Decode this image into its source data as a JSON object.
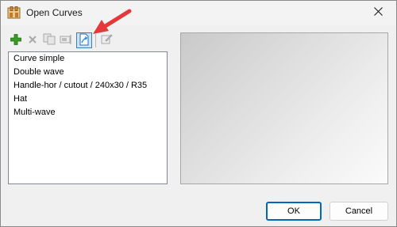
{
  "window": {
    "title": "Open Curves",
    "icons": {
      "app": "curves-app-icon",
      "close": "close-icon"
    }
  },
  "toolbar": {
    "buttons": [
      {
        "name": "add",
        "icon": "plus-icon",
        "enabled": true
      },
      {
        "name": "delete",
        "icon": "delete-x-icon",
        "enabled": false
      },
      {
        "name": "copy",
        "icon": "copy-icon",
        "enabled": false
      },
      {
        "name": "rename",
        "icon": "rename-icon",
        "enabled": false
      },
      {
        "name": "import",
        "icon": "import-icon",
        "enabled": true,
        "active": true
      },
      {
        "name": "edit",
        "icon": "edit-icon",
        "enabled": false
      }
    ]
  },
  "curves_list": {
    "items": [
      "Curve simple",
      "Double wave",
      "Handle-hor / cutout / 240x30 / R35",
      "Hat",
      "Multi-wave"
    ]
  },
  "buttons": {
    "ok_label": "OK",
    "cancel_label": "Cancel"
  },
  "colors": {
    "accent": "#0067c0",
    "add_green": "#3a9d23",
    "arrow_red": "#e5383b",
    "active_bg": "#cce4f7"
  }
}
